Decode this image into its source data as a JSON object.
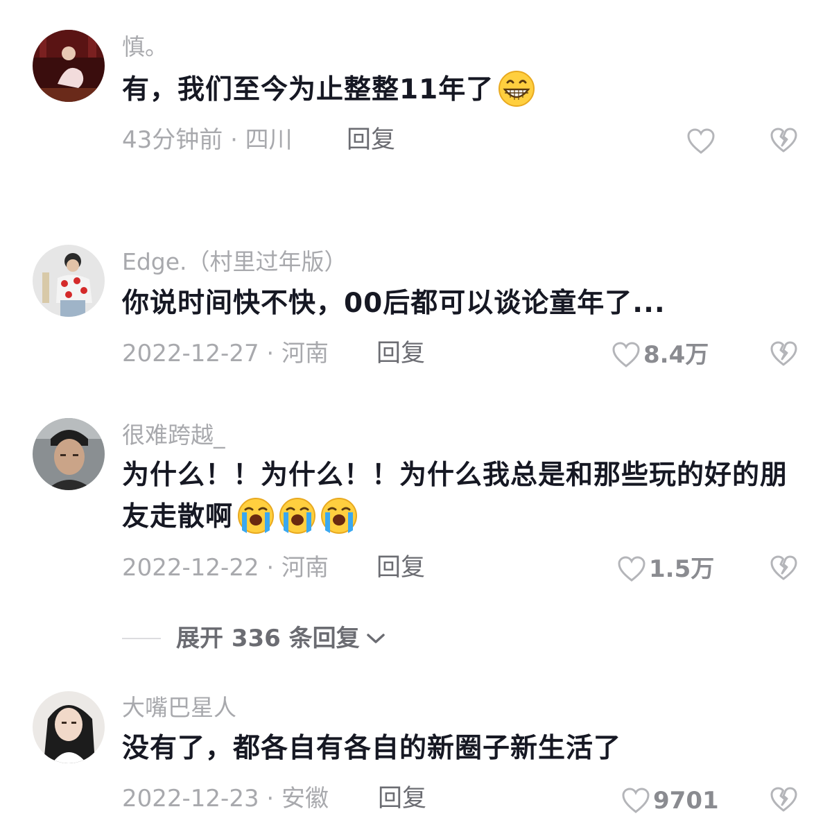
{
  "comments": [
    {
      "username": "慎。",
      "content": "有，我们至今为止整整11年了",
      "emojis": [
        "grinning-face"
      ],
      "time_location": "43分钟前 · 四川",
      "reply_label": "回复",
      "like_count": ""
    },
    {
      "username": "Edge.（村里过年版）",
      "content": "你说时间快不快，00后都可以谈论童年了...",
      "emojis": [],
      "time_location": "2022-12-27 · 河南",
      "reply_label": "回复",
      "like_count": "8.4万"
    },
    {
      "username": "很难跨越_",
      "content": "为什么！！为什么！！为什么我总是和那些玩的好的朋友走散啊",
      "emojis": [
        "loudly-crying-face",
        "loudly-crying-face",
        "loudly-crying-face"
      ],
      "time_location": "2022-12-22 · 河南",
      "reply_label": "回复",
      "like_count": "1.5万"
    },
    {
      "username": "大嘴巴星人",
      "content": "没有了，都各自有各自的新圈子新生活了",
      "emojis": [],
      "time_location": "2022-12-23 · 安徽",
      "reply_label": "回复",
      "like_count": "9701"
    }
  ],
  "expand_replies": {
    "label": "展开 336 条回复"
  },
  "icons": {
    "like": "heart-outline-icon",
    "dislike": "broken-heart-icon",
    "expand": "chevron-down-icon"
  },
  "colors": {
    "text_primary": "#161823",
    "text_secondary": "#a8a9ad",
    "reply": "#6b6c72",
    "icon": "#b4b5b9"
  }
}
